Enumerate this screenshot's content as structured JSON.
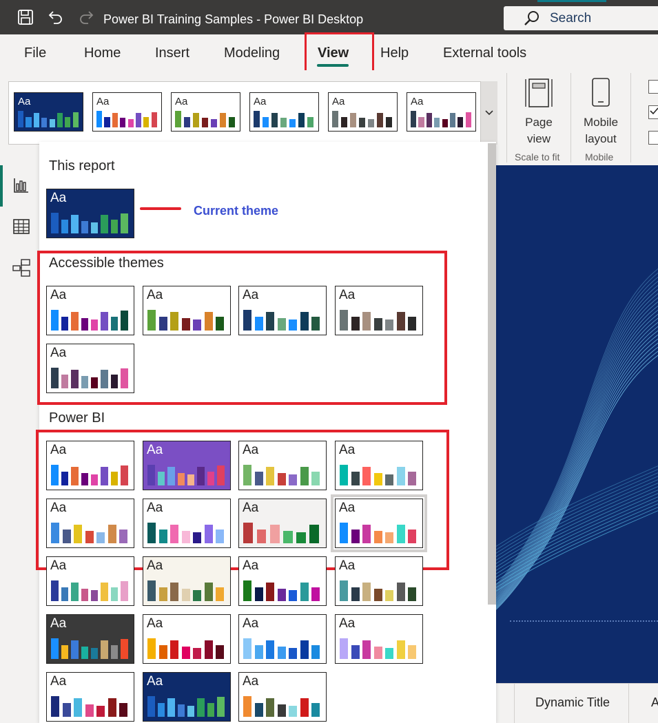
{
  "app": {
    "title": "Power BI Training Samples - Power BI Desktop",
    "search_label": "Search"
  },
  "menu": {
    "items": [
      "File",
      "Home",
      "Insert",
      "Modeling",
      "View",
      "Help",
      "External tools"
    ],
    "active": "View"
  },
  "ribbon": {
    "page_view_label": "Page view",
    "mobile_layout_label": "Mobile layout",
    "group_scale": "Scale to fit",
    "group_mobile": "Mobile"
  },
  "dropdown": {
    "this_report_title": "This report",
    "current_theme_label": "Current theme",
    "accessible_title": "Accessible themes",
    "powerbi_title": "Power BI"
  },
  "tabs": {
    "dynamic_title": "Dynamic Title",
    "next_tab": "A"
  },
  "themes": {
    "thumb_text": "Aa",
    "gallery": [
      {
        "bg": "#0e2b6b",
        "fg": "#ffffff",
        "bars": [
          "#1b5dbf",
          "#2a8ae0",
          "#4fb3f0",
          "#3d7ad4",
          "#5ec0e8",
          "#2b9c5a",
          "#41a64f",
          "#5bb860"
        ]
      },
      {
        "bg": "#ffffff",
        "fg": "#252423",
        "bars": [
          "#118dff",
          "#12239e",
          "#e66c37",
          "#6b007b",
          "#e044a7",
          "#744ec2",
          "#d9b300",
          "#d64550"
        ]
      },
      {
        "bg": "#ffffff",
        "fg": "#252423",
        "bars": [
          "#5ca33a",
          "#2e3a82",
          "#b4a017",
          "#7a1d1d",
          "#6a3fb5",
          "#d9822b",
          "#1b5b1b"
        ]
      },
      {
        "bg": "#ffffff",
        "fg": "#252423",
        "bars": [
          "#1b3a6b",
          "#1a8fff",
          "#23424f",
          "#6aa87d",
          "#1a8fff",
          "#0f3c5a",
          "#4fa66a"
        ]
      },
      {
        "bg": "#ffffff",
        "fg": "#252423",
        "bars": [
          "#6a7575",
          "#2d2424",
          "#a89080",
          "#3a4040",
          "#7f8587",
          "#5a3a32",
          "#2a2a2a"
        ]
      },
      {
        "bg": "#ffffff",
        "fg": "#252423",
        "bars": [
          "#2d3e4f",
          "#c07ba0",
          "#5a3060",
          "#7a9cb0",
          "#5a0020",
          "#5e7a90",
          "#2a1a30",
          "#e055a0"
        ]
      }
    ],
    "current": {
      "bg": "#0e2b6b",
      "fg": "#ffffff",
      "bars": [
        "#1b5dbf",
        "#2a8ae0",
        "#4fb3f0",
        "#3d7ad4",
        "#5ec0e8",
        "#2b9c5a",
        "#41a64f",
        "#5bb860"
      ]
    },
    "accessible": [
      {
        "bg": "#ffffff",
        "fg": "#252423",
        "bars": [
          "#118dff",
          "#12239e",
          "#e66c37",
          "#6b007b",
          "#e044a7",
          "#744ec2",
          "#197278",
          "#0a4a3a"
        ]
      },
      {
        "bg": "#ffffff",
        "fg": "#252423",
        "bars": [
          "#5ca33a",
          "#2e3a82",
          "#b4a017",
          "#7a1d1d",
          "#6a3fb5",
          "#d9822b",
          "#1b5b1b"
        ]
      },
      {
        "bg": "#ffffff",
        "fg": "#252423",
        "bars": [
          "#1b3a6b",
          "#1a8fff",
          "#23424f",
          "#6aa87d",
          "#1a8fff",
          "#0f3c5a",
          "#235a40"
        ]
      },
      {
        "bg": "#ffffff",
        "fg": "#252423",
        "bars": [
          "#6a7575",
          "#2d2424",
          "#a89080",
          "#3a4040",
          "#7f8587",
          "#5a3a32",
          "#2a2a2a"
        ]
      },
      {
        "bg": "#ffffff",
        "fg": "#252423",
        "bars": [
          "#2d3e4f",
          "#c07ba0",
          "#5a3060",
          "#7a9cb0",
          "#5a0020",
          "#5e7a90",
          "#2a1a30",
          "#e055a0"
        ]
      }
    ],
    "powerbi": [
      {
        "bg": "#ffffff",
        "fg": "#252423",
        "bars": [
          "#118dff",
          "#12239e",
          "#e66c37",
          "#6b007b",
          "#e044a7",
          "#744ec2",
          "#d9b300",
          "#d64550"
        ]
      },
      {
        "bg": "#7b4fc4",
        "fg": "#ffffff",
        "bars": [
          "#5a3fb0",
          "#5ec8c8",
          "#6aa0e8",
          "#f08a5d",
          "#f5b48a",
          "#5a2a8a",
          "#e0408a",
          "#e04060"
        ]
      },
      {
        "bg": "#ffffff",
        "fg": "#252423",
        "bars": [
          "#74b566",
          "#4a5a8a",
          "#e4c440",
          "#c8403a",
          "#8a6ac8",
          "#4a9a4a",
          "#8ad8b0"
        ]
      },
      {
        "bg": "#ffffff",
        "fg": "#252423",
        "bars": [
          "#01b8aa",
          "#374649",
          "#fd625e",
          "#f2c80f",
          "#5f6b6d",
          "#8ad4eb",
          "#a66999"
        ]
      },
      {
        "bg": "#ffffff",
        "fg": "#252423",
        "bars": [
          "#3a8ae0",
          "#4a5a8a",
          "#e4c420",
          "#d84a3a",
          "#8ab8e8",
          "#d08a4a",
          "#9a6ab8"
        ]
      },
      {
        "bg": "#ffffff",
        "fg": "#252423",
        "bars": [
          "#0b5a5a",
          "#128a8a",
          "#f06ab0",
          "#f8b8d8",
          "#2a1a8a",
          "#8a6ae8",
          "#8ab8f8"
        ]
      },
      {
        "bg": "#f3f2f1",
        "fg": "#252423",
        "bars": [
          "#b83a3a",
          "#e06a6a",
          "#f0a0a0",
          "#4ab86a",
          "#1a8a3a",
          "#0a6a2a"
        ]
      },
      {
        "bg": "#ffffff",
        "fg": "#252423",
        "bars": [
          "#118dff",
          "#6b007b",
          "#c83aa0",
          "#f58a4a",
          "#f5a870",
          "#3ad8c8",
          "#e04060"
        ],
        "selected": true
      },
      {
        "bg": "#ffffff",
        "fg": "#252423",
        "bars": [
          "#2a3a9a",
          "#3a7ab8",
          "#3aa88a",
          "#c85a8a",
          "#8a4a9a",
          "#f0c040",
          "#8ad8c0",
          "#e8a0c8"
        ]
      },
      {
        "bg": "#f7f4ec",
        "fg": "#252423",
        "bars": [
          "#3a5a6a",
          "#c8a040",
          "#8a6a4a",
          "#e0d0b0",
          "#2a7a4a",
          "#5a7a3a",
          "#f0a830"
        ]
      },
      {
        "bg": "#ffffff",
        "fg": "#252423",
        "bars": [
          "#1a7a1a",
          "#0a1a4a",
          "#8a1a1a",
          "#6a2a9a",
          "#1a5ad8",
          "#2a9a9a",
          "#c010a0"
        ]
      },
      {
        "bg": "#ffffff",
        "fg": "#252423",
        "bars": [
          "#4a9aa0",
          "#2a3a4a",
          "#c8b080",
          "#7a4a2a",
          "#e0d060",
          "#5a5a5a",
          "#2a4a2a"
        ]
      },
      {
        "bg": "#3a3a3a",
        "fg": "#ffffff",
        "bars": [
          "#1a8fff",
          "#f5b820",
          "#3a7ad8",
          "#1ab0a0",
          "#1a7a9a",
          "#c8a870",
          "#8a8a8a",
          "#f04a2a"
        ]
      },
      {
        "bg": "#ffffff",
        "fg": "#252423",
        "bars": [
          "#f5b000",
          "#e06000",
          "#d01a1a",
          "#e00060",
          "#c01a4a",
          "#8a0a2a",
          "#5a0a1a"
        ]
      },
      {
        "bg": "#ffffff",
        "fg": "#252423",
        "bars": [
          "#8ac8f8",
          "#4aa8f0",
          "#1a78e0",
          "#3a9af0",
          "#1a58c8",
          "#0a3aa0",
          "#1a8ae0"
        ]
      },
      {
        "bg": "#ffffff",
        "fg": "#252423",
        "bars": [
          "#b8a8f8",
          "#3a4ab8",
          "#c83aa0",
          "#f08aa0",
          "#3ad8c8",
          "#f0d040",
          "#f8c870"
        ]
      },
      {
        "bg": "#ffffff",
        "fg": "#252423",
        "bars": [
          "#1a2a7a",
          "#3a4a9a",
          "#4ab8e0",
          "#e04a8a",
          "#c01a3a",
          "#8a1a1a",
          "#5a0a1a"
        ]
      },
      {
        "bg": "#0e2b6b",
        "fg": "#ffffff",
        "bars": [
          "#1b5dbf",
          "#2a8ae0",
          "#4fb3f0",
          "#3d7ad4",
          "#5ec0e8",
          "#2b9c5a",
          "#41a64f",
          "#5bb860"
        ]
      },
      {
        "bg": "#ffffff",
        "fg": "#252423",
        "bars": [
          "#f08a30",
          "#1a4a6a",
          "#5a6a3a",
          "#3a3a3a",
          "#8ad8e0",
          "#d01a1a",
          "#1a8aa0"
        ]
      }
    ]
  }
}
